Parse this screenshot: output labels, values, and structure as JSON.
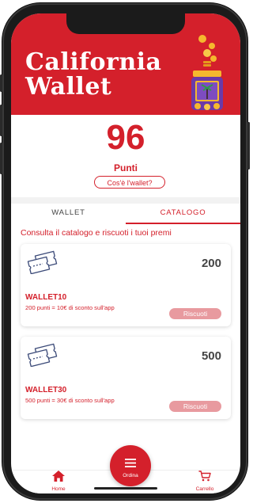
{
  "header": {
    "title_line1": "California",
    "title_line2": "Wallet"
  },
  "points": {
    "value": "96",
    "label": "Punti",
    "info_button": "Cos'è l'wallet?"
  },
  "tabs": [
    {
      "label": "WALLET",
      "active": false
    },
    {
      "label": "CATALOGO",
      "active": true
    }
  ],
  "catalog": {
    "subtitle": "Consulta il catalogo e riscuoti i tuoi premi",
    "items": [
      {
        "cost": "200",
        "code": "WALLET10",
        "description": "200 punti = 10€ di sconto sull'app",
        "button": "Riscuoti"
      },
      {
        "cost": "500",
        "code": "WALLET30",
        "description": "500 punti = 30€ di sconto sull'app",
        "button": "Riscuoti"
      }
    ]
  },
  "bottom_nav": {
    "home": {
      "label": "Home",
      "icon": "home-icon"
    },
    "order": {
      "label": "Ordina",
      "icon": "menu-icon"
    },
    "cart": {
      "label": "Carrello",
      "icon": "cart-icon"
    }
  },
  "colors": {
    "brand_red": "#d4202b",
    "button_pink": "#e89a9f"
  }
}
